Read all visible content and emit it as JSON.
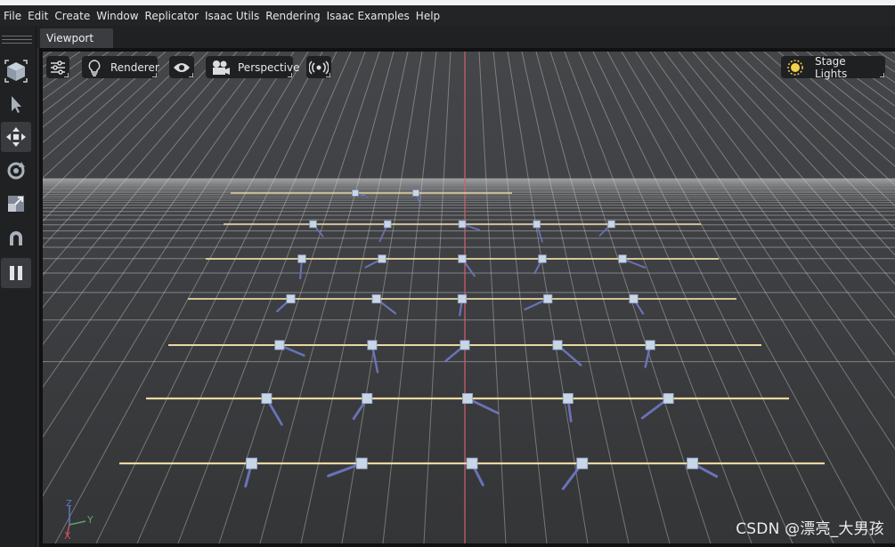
{
  "menubar": {
    "items": [
      "File",
      "Edit",
      "Create",
      "Window",
      "Replicator",
      "Isaac Utils",
      "Rendering",
      "Isaac Examples",
      "Help"
    ]
  },
  "toolbar": {
    "tools": [
      {
        "name": "select-mode-icon",
        "active": false
      },
      {
        "name": "select-arrow-icon",
        "active": false
      },
      {
        "name": "move-icon",
        "active": true
      },
      {
        "name": "rotate-icon",
        "active": false
      },
      {
        "name": "scale-icon",
        "active": false
      },
      {
        "name": "snap-magnet-icon",
        "active": false
      },
      {
        "name": "pause-icon",
        "active": true
      }
    ]
  },
  "tab": {
    "label": "Viewport"
  },
  "viewport": {
    "renderer_label": "Renderer",
    "camera_label": "Perspective",
    "lights_label": "Stage Lights",
    "axis_labels": {
      "z": "Z",
      "y": "Y",
      "x": "X"
    }
  },
  "scene": {
    "rows": 7,
    "robots_per_row": [
      2,
      5,
      5,
      5,
      5,
      5,
      5
    ],
    "colors": {
      "rail": "#e8d9a0",
      "leg": "#6a72b8",
      "body": "#c9d6e8",
      "origin_line": "#d06070",
      "grid": "#d8d8d8"
    }
  },
  "watermark": "CSDN @漂亮_大男孩"
}
